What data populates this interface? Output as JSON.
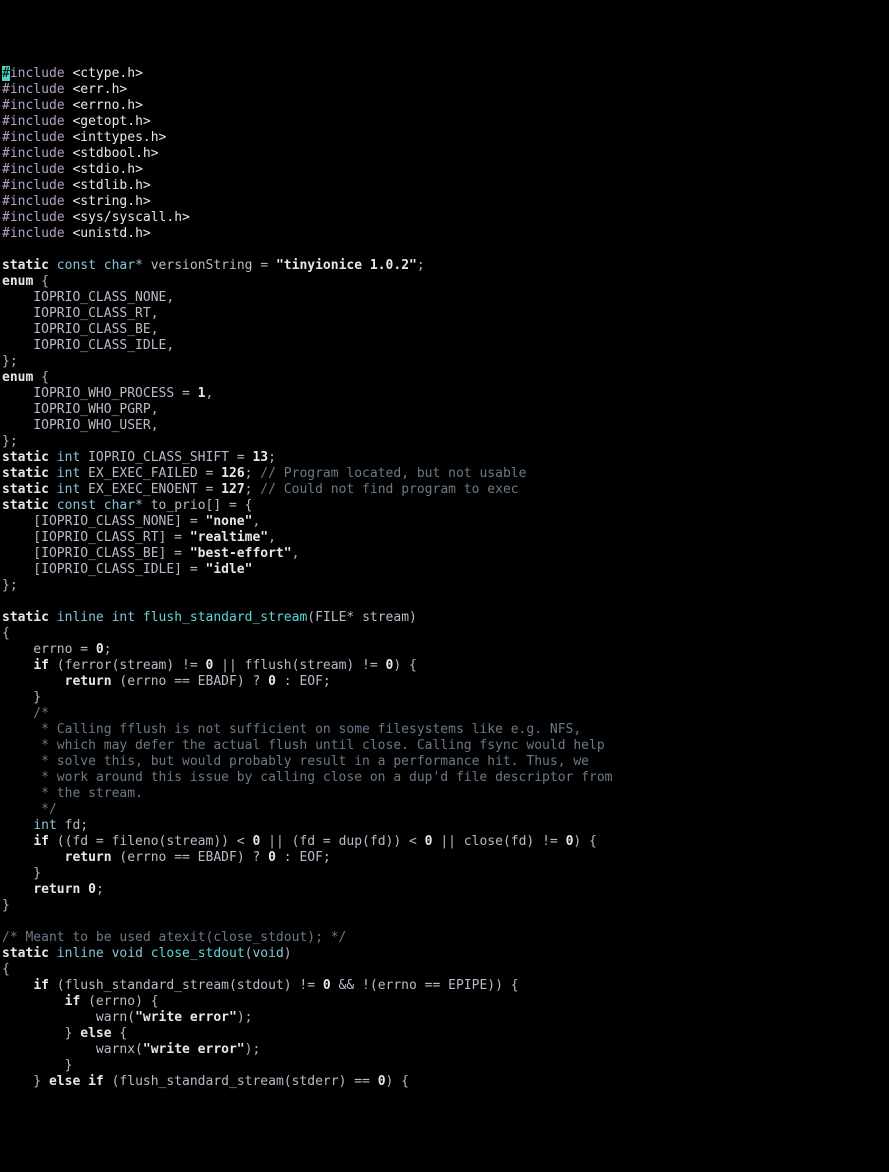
{
  "cursor_char": "#",
  "includes": [
    "include <ctype.h>",
    "#include <err.h>",
    "#include <errno.h>",
    "#include <getopt.h>",
    "#include <inttypes.h>",
    "#include <stdbool.h>",
    "#include <stdio.h>",
    "#include <stdlib.h>",
    "#include <string.h>",
    "#include <sys/syscall.h>",
    "#include <unistd.h>"
  ],
  "decl": {
    "static": "static",
    "const": "const",
    "char": "char",
    "star": "*",
    "versionName": " versionString ",
    "eq": "= ",
    "versionStr": "\"tinyionice 1.0.2\"",
    "semi": ";"
  },
  "enum1": {
    "enum": "enum",
    "open": " {",
    "items": [
      "    IOPRIO_CLASS_NONE,",
      "    IOPRIO_CLASS_RT,",
      "    IOPRIO_CLASS_BE,",
      "    IOPRIO_CLASS_IDLE,"
    ],
    "close": "};"
  },
  "enum2": {
    "enum": "enum",
    "open": " {",
    "items": [
      "    IOPRIO_WHO_PROCESS = ",
      "    IOPRIO_WHO_PGRP,",
      "    IOPRIO_WHO_USER,"
    ],
    "one": "1",
    "close": "};"
  },
  "shift_line": {
    "static": "static",
    "int": "int",
    "name": " IOPRIO_CLASS_SHIFT = ",
    "val": "13",
    "semi": ";"
  },
  "exec_failed": {
    "static": "static",
    "int": "int",
    "name": " EX_EXEC_FAILED = ",
    "val": "126",
    "semi": ";",
    "comment": " // Program located, but not usable"
  },
  "exec_enoent": {
    "static": "static",
    "int": "int",
    "name": " EX_EXEC_ENOENT = ",
    "val": "127",
    "semi": ";",
    "comment": " // Could not find program to exec"
  },
  "to_prio": {
    "static": "static",
    "const": "const",
    "char": "char",
    "star": "*",
    "name": " to_prio[] = {",
    "items": [
      {
        "idx": "    [IOPRIO_CLASS_NONE] = ",
        "str": "\"none\"",
        "c": ","
      },
      {
        "idx": "    [IOPRIO_CLASS_RT] = ",
        "str": "\"realtime\"",
        "c": ","
      },
      {
        "idx": "    [IOPRIO_CLASS_BE] = ",
        "str": "\"best-effort\"",
        "c": ","
      },
      {
        "idx": "    [IOPRIO_CLASS_IDLE] = ",
        "str": "\"idle\"",
        "c": ""
      }
    ],
    "close": "};"
  },
  "fss": {
    "sig1": "static",
    "sig2": "inline",
    "sig3": "int",
    "name": "flush_standard_stream",
    "sig4": "(",
    "file": "FILE",
    "star": "*",
    "arg": " stream)",
    "open": "{",
    "errno_line_a": "    errno = ",
    "zero": "0",
    "errno_line_b": ";",
    "if1a": "    ",
    "if1b": "if",
    "if1c": " (ferror(stream) != ",
    "if1d": " || fflush(stream) != ",
    "if1e": ") {",
    "ret1a": "        ",
    "ret1b": "return",
    "ret1c": " (errno == EBADF) ? ",
    "ret1d": " : EOF;",
    "close1": "    }",
    "cmt": [
      "    /*",
      "     * Calling fflush is not sufficient on some filesystems like e.g. NFS,",
      "     * which may defer the actual flush until close. Calling fsync would help",
      "     * solve this, but would probably result in a performance hit. Thus, we",
      "     * work around this issue by calling close on a dup'd file descriptor from",
      "     * the stream.",
      "     */"
    ],
    "fd": "    ",
    "fd2": "int",
    "fd3": " fd;",
    "if2a": "    ",
    "if2b": "if",
    "if2c": " ((fd = fileno(stream)) < ",
    "if2d": " || (fd = dup(fd)) < ",
    "if2e": " || close(fd) != ",
    "if2f": ") {",
    "ret3a": "    ",
    "ret3b": "return",
    "ret3c": " ",
    "close2": "}"
  },
  "cmt2": "/* Meant to be used atexit(close_stdout); */",
  "cs": {
    "sig1": "static",
    "sig2": "inline",
    "sig3": "void",
    "name": "close_stdout",
    "sig4": "(",
    "void": "void",
    "close": ")",
    "open": "{",
    "if1a": "    ",
    "if1b": "if",
    "if1c": " (flush_standard_stream(stdout) != ",
    "if1d": " && !(errno == EPIPE)) {",
    "if2a": "        ",
    "if2b": "if",
    "if2c": " (errno) {",
    "warn1": "            warn(",
    "we": "\"write error\"",
    "warn2": ");",
    "else1": "        } ",
    "else1b": "else",
    "else1c": " {",
    "warnx1": "            warnx(",
    "warnx2": ");",
    "close3": "        }",
    "elseif_a": "    } ",
    "elseif_b": "else",
    "elseif_c": " ",
    "elseif_d": "if",
    "elseif_e": " (flush_standard_stream(stderr) == ",
    "elseif_f": ") {"
  }
}
